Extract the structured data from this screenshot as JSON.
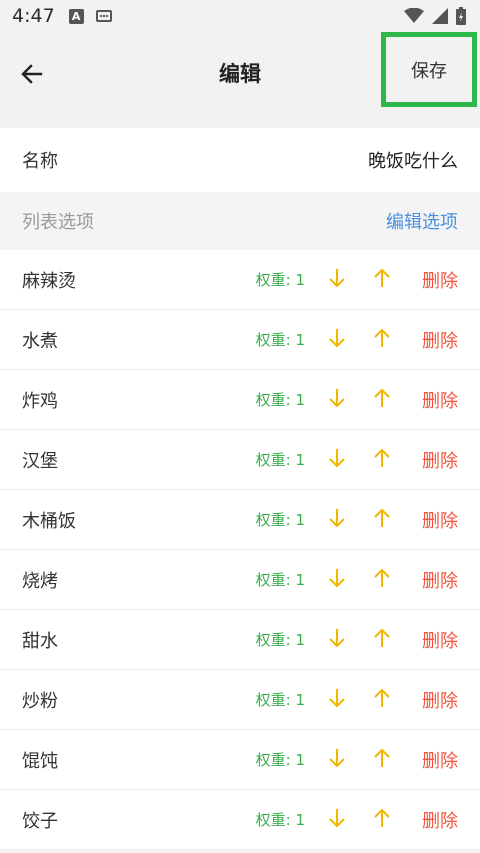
{
  "status_bar": {
    "time": "4:47",
    "notification_letter": "A"
  },
  "header": {
    "title": "编辑",
    "save_label": "保存"
  },
  "name_row": {
    "label": "名称",
    "value": "晚饭吃什么"
  },
  "list_section": {
    "label": "列表选项",
    "edit_label": "编辑选项"
  },
  "weight_label": "权重: 1",
  "delete_label": "删除",
  "options": [
    {
      "name": "麻辣烫",
      "weight": "权重: 1"
    },
    {
      "name": "水煮",
      "weight": "权重: 1"
    },
    {
      "name": "炸鸡",
      "weight": "权重: 1"
    },
    {
      "name": "汉堡",
      "weight": "权重: 1"
    },
    {
      "name": "木桶饭",
      "weight": "权重: 1"
    },
    {
      "name": "烧烤",
      "weight": "权重: 1"
    },
    {
      "name": "甜水",
      "weight": "权重: 1"
    },
    {
      "name": "炒粉",
      "weight": "权重: 1"
    },
    {
      "name": "馄饨",
      "weight": "权重: 1"
    },
    {
      "name": "饺子",
      "weight": "权重: 1"
    }
  ],
  "colors": {
    "save_highlight": "#2fb84a",
    "weight_green": "#3cae4c",
    "arrow_yellow": "#f5b400",
    "delete_red": "#f0553a",
    "link_blue": "#4a8fe0"
  },
  "icons": {
    "back": "arrow-left-icon",
    "down": "arrow-down-icon",
    "up": "arrow-up-icon",
    "wifi": "wifi-icon",
    "signal": "signal-icon",
    "battery": "battery-icon",
    "keyboard": "keyboard-icon"
  }
}
